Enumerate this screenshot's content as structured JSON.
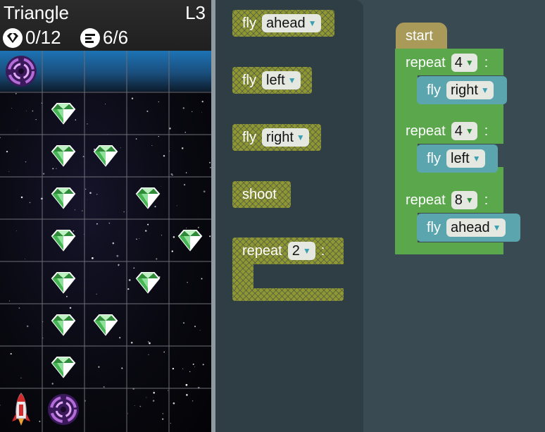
{
  "header": {
    "title": "Triangle",
    "level": "L3",
    "gems": "0/12",
    "blocks": "6/6",
    "gem_icon": "gem-icon",
    "code_icon": "code-icon"
  },
  "board": {
    "cols": 5,
    "rows": 9,
    "gems": [
      [
        1,
        1
      ],
      [
        1,
        2
      ],
      [
        2,
        2
      ],
      [
        1,
        3
      ],
      [
        3,
        3
      ],
      [
        1,
        4
      ],
      [
        4,
        4
      ],
      [
        1,
        5
      ],
      [
        3,
        5
      ],
      [
        1,
        6
      ],
      [
        2,
        6
      ],
      [
        1,
        7
      ]
    ],
    "portals": [
      [
        0,
        0
      ],
      [
        1,
        8
      ]
    ],
    "ship": [
      0,
      8
    ]
  },
  "toolbox": {
    "fly_label": "fly",
    "shoot_label": "shoot",
    "repeat_label": "repeat",
    "fly_ahead": "ahead",
    "fly_left": "left",
    "fly_right": "right",
    "repeat_count": "2"
  },
  "workspace": {
    "start_label": "start",
    "colon": ":",
    "loops": [
      {
        "label": "repeat",
        "count": "4",
        "fly": "fly",
        "dir": "right"
      },
      {
        "label": "repeat",
        "count": "4",
        "fly": "fly",
        "dir": "left"
      },
      {
        "label": "repeat",
        "count": "8",
        "fly": "fly",
        "dir": "ahead"
      }
    ]
  },
  "colors": {
    "toolbox_block": "#8f9632",
    "loop_block": "#5ba84c",
    "fly_block": "#5ba5ae",
    "start_block": "#a99a5a"
  }
}
